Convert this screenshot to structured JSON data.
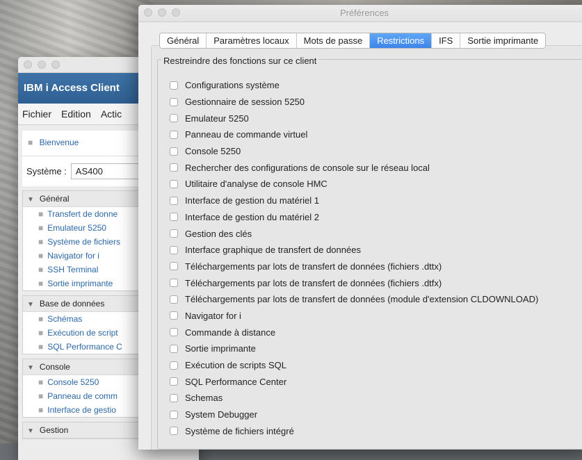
{
  "background_window": {
    "banner_title": "IBM i Access Client",
    "menus": [
      "Fichier",
      "Edition",
      "Actic"
    ],
    "welcome_link": "Bienvenue",
    "system_label": "Système :",
    "system_value": "AS400",
    "groups": [
      {
        "title": "Général",
        "items": [
          "Transfert de donne",
          "Emulateur 5250",
          "Système de fichiers",
          "Navigator for i",
          "SSH Terminal",
          "Sortie imprimante"
        ]
      },
      {
        "title": "Base de données",
        "items": [
          "Schémas",
          "Exécution de script",
          "SQL Performance C"
        ]
      },
      {
        "title": "Console",
        "items": [
          "Console 5250",
          "Panneau de comm",
          "Interface de gestio"
        ]
      },
      {
        "title": "Gestion",
        "items": []
      }
    ]
  },
  "preferences": {
    "window_title": "Préférences",
    "tabs": [
      "Général",
      "Paramètres locaux",
      "Mots de passe",
      "Restrictions",
      "IFS",
      "Sortie imprimante"
    ],
    "active_tab": "Restrictions",
    "section_title": "Restreindre des fonctions sur ce client",
    "restrictions": [
      {
        "label": "Configurations système",
        "checked": false
      },
      {
        "label": "Gestionnaire de session 5250",
        "checked": false
      },
      {
        "label": "Emulateur 5250",
        "checked": false
      },
      {
        "label": "Panneau de commande virtuel",
        "checked": false
      },
      {
        "label": "Console 5250",
        "checked": false
      },
      {
        "label": "Rechercher des configurations de console sur le réseau local",
        "checked": false
      },
      {
        "label": "Utilitaire d'analyse de console HMC",
        "checked": false
      },
      {
        "label": "Interface de gestion du matériel 1",
        "checked": false
      },
      {
        "label": "Interface de gestion du matériel 2",
        "checked": false
      },
      {
        "label": "Gestion des clés",
        "checked": false
      },
      {
        "label": "Interface graphique de transfert de données",
        "checked": false
      },
      {
        "label": "Téléchargements par lots de transfert de données (fichiers .dttx)",
        "checked": false
      },
      {
        "label": "Téléchargements par lots de transfert de données (fichiers .dtfx)",
        "checked": false
      },
      {
        "label": "Téléchargements par lots de transfert de données (module d'extension CLDOWNLOAD)",
        "checked": false
      },
      {
        "label": "Navigator for i",
        "checked": false
      },
      {
        "label": "Commande à distance",
        "checked": false
      },
      {
        "label": "Sortie imprimante",
        "checked": false
      },
      {
        "label": "Exécution de scripts SQL",
        "checked": false
      },
      {
        "label": "SQL Performance Center",
        "checked": false
      },
      {
        "label": "Schemas",
        "checked": false
      },
      {
        "label": "System Debugger",
        "checked": false
      },
      {
        "label": "Système de fichiers intégré",
        "checked": false
      }
    ]
  },
  "colors": {
    "banner": "#3f73a8",
    "active_tab": "#3d86ea",
    "link": "#2b67a6"
  }
}
